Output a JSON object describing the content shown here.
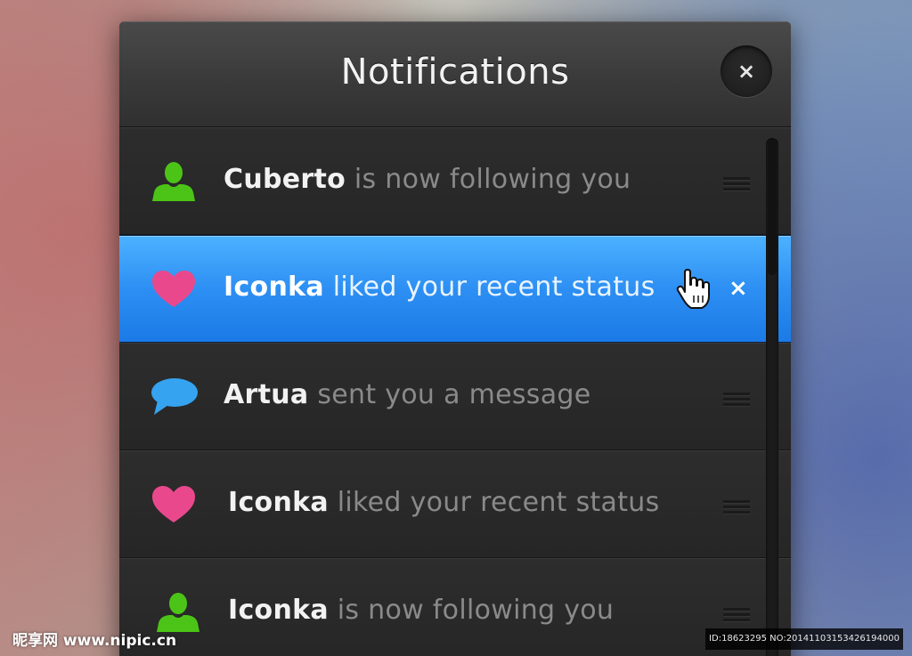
{
  "panel": {
    "title": "Notifications",
    "close_label": "×"
  },
  "notifications": [
    {
      "actor": "Cuberto",
      "action": "is now following you",
      "icon": "user-icon",
      "icon_color": "#4cc417",
      "state": "normal"
    },
    {
      "actor": "Iconka",
      "action": "liked your recent status",
      "icon": "heart-icon",
      "icon_color": "#e9498c",
      "state": "active",
      "dismiss_label": "×"
    },
    {
      "actor": "Artua",
      "action": "sent you a message",
      "icon": "speech-bubble-icon",
      "icon_color": "#35a3f0",
      "state": "normal"
    },
    {
      "actor": "Iconka",
      "action": "liked your recent status",
      "icon": "heart-icon",
      "icon_color": "#e9498c",
      "state": "normal"
    },
    {
      "actor": "Iconka",
      "action": "is now following you",
      "icon": "user-icon",
      "icon_color": "#4cc417",
      "state": "normal"
    }
  ],
  "colors": {
    "active_row": "#2d8ff3",
    "panel_bg": "#262626",
    "action_text": "#8a8a8a"
  },
  "watermark": {
    "left": "昵享网 www.nipic.cn",
    "right": "ID:18623295 NO:20141103153426194000"
  }
}
